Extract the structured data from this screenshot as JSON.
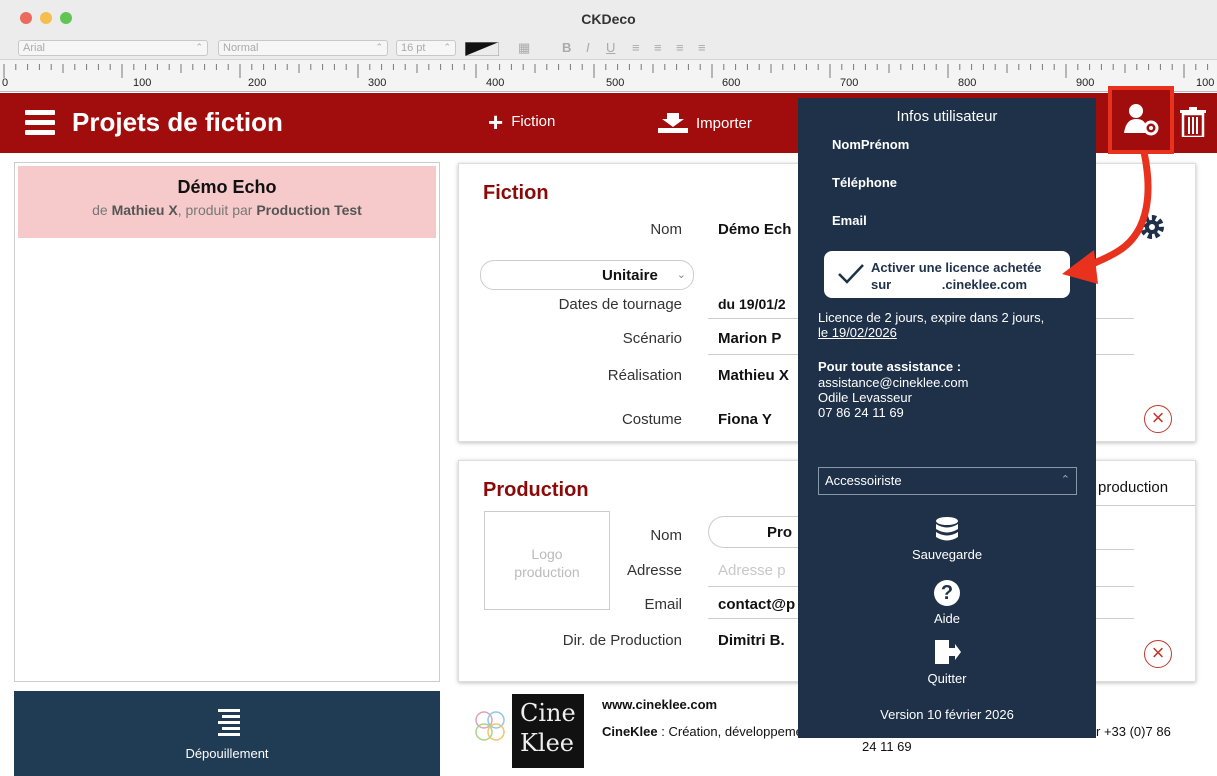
{
  "window": {
    "title": "CKDeco"
  },
  "format_bar": {
    "font": "Arial",
    "style": "Normal",
    "size": "16 pt"
  },
  "ruler": {
    "labels": [
      "0",
      "100",
      "200",
      "300",
      "400",
      "500",
      "600",
      "700",
      "800",
      "900",
      "100"
    ]
  },
  "header": {
    "title": "Projets de fiction",
    "add_fiction_label": "Fiction",
    "import_label": "Importer"
  },
  "project_list": {
    "items": [
      {
        "name": "Démo Echo",
        "prefix": "de ",
        "author": "Mathieu X",
        "middle": ", produit par ",
        "producer": "Production Test"
      }
    ]
  },
  "depouillement_label": "Dépouillement",
  "fiction_card": {
    "title": "Fiction",
    "nom_label": "Nom",
    "nom_value": "Démo Ech",
    "type_value": "Unitaire",
    "dates_label": "Dates de tournage",
    "dates_value": "du 19/01/2",
    "scenario_label": "Scénario",
    "scenario_value": "Marion P",
    "realisation_label": "Réalisation",
    "realisation_value": "Mathieu X",
    "costume_label": "Costume",
    "costume_value": "Fiona Y"
  },
  "production_card": {
    "title": "Production",
    "logo_placeholder_1": "Logo",
    "logo_placeholder_2": "production",
    "nom_label": "Nom",
    "nom_value": "Pro",
    "adresse_label": "Adresse",
    "adresse_placeholder": "Adresse p",
    "email_label": "Email",
    "email_value": "contact@p",
    "dir_label": "Dir. de Production",
    "dir_value": "Dimitri B.",
    "side_label": "production"
  },
  "footer": {
    "logo_line1": "Cine",
    "logo_line2": "Klee",
    "url": "www.cineklee.com",
    "company": "CineKlee",
    "desc_start": " : Création, développeme",
    "desc_end": "r +33 (0)7 86",
    "phone_tail": "24 11 69"
  },
  "user_panel": {
    "title": "Infos utilisateur",
    "nom_prenom": "NomPrénom",
    "telephone": "Téléphone",
    "email": "Email",
    "license_line1": "Activer une licence achetée",
    "license_line2": "sur              .cineklee.com",
    "license_info_1": "Licence de 2 jours, expire dans 2 jours,",
    "license_info_2": "le 19/02/2026",
    "assist_title": "Pour toute assistance :",
    "assist_email": "assistance@cineklee.com",
    "assist_name": "Odile Levasseur",
    "assist_phone": "07 86 24 11 69",
    "role_value": "Accessoiriste",
    "backup_label": "Sauvegarde",
    "help_label": "Aide",
    "quit_label": "Quitter",
    "version": "Version 10 février 2026"
  },
  "colors": {
    "brand_red": "#a10c0c",
    "panel_navy": "#1e3148",
    "highlight": "#e8321e"
  }
}
